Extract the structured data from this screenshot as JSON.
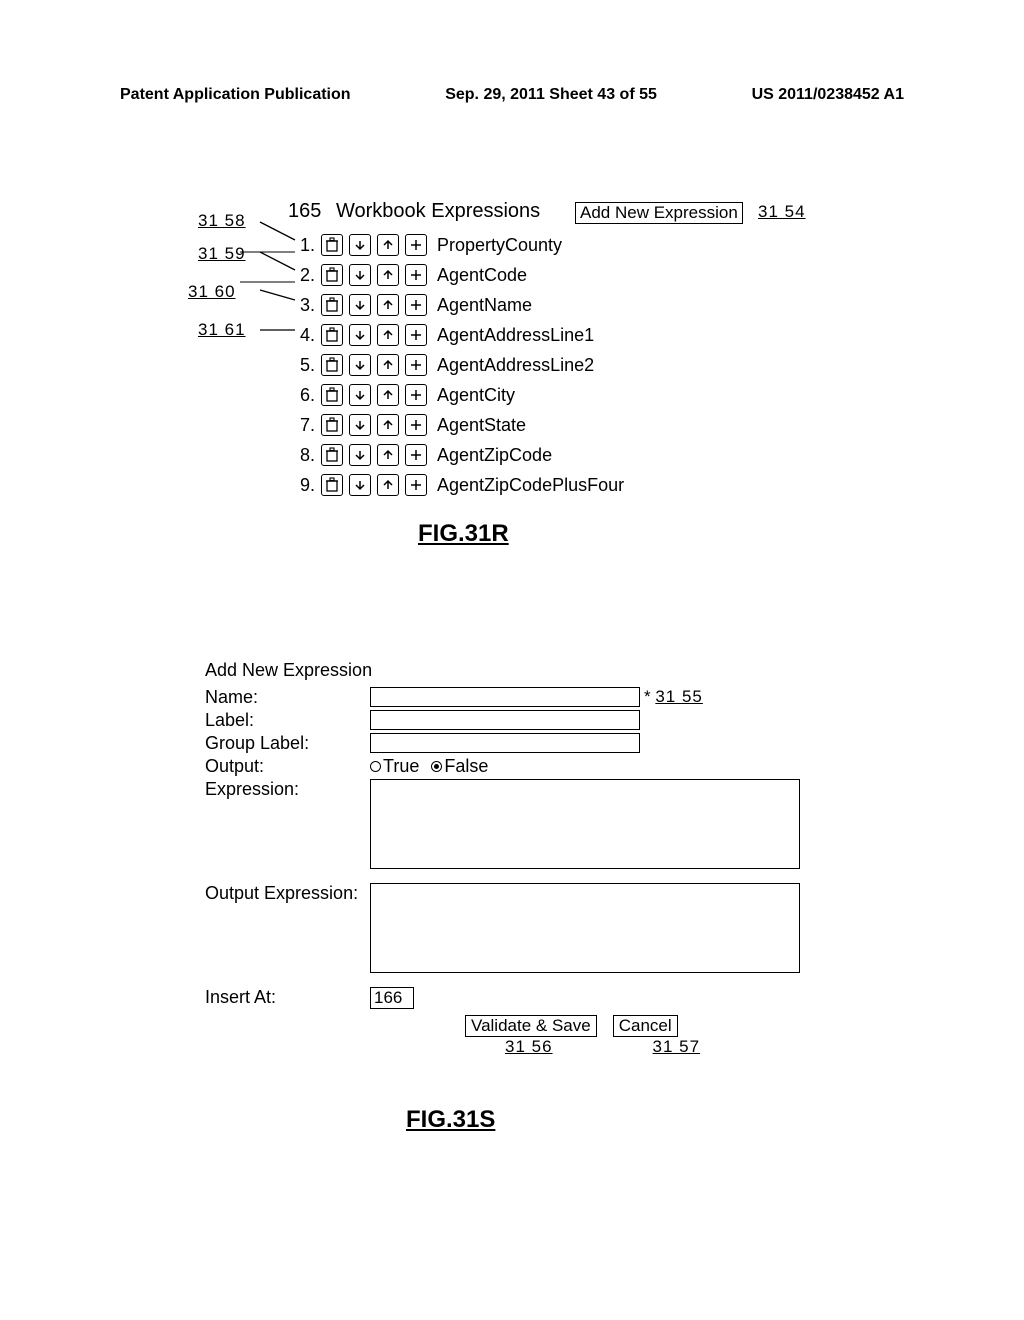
{
  "header": {
    "left": "Patent Application Publication",
    "mid": "Sep. 29, 2011  Sheet 43 of 55",
    "right": "US 2011/0238452 A1"
  },
  "fig_r": {
    "count": "165",
    "title": "Workbook Expressions",
    "add_btn": "Add New Expression",
    "ref_right": "31  54",
    "label": "FIG.31R",
    "leads": [
      {
        "ref": "31  58"
      },
      {
        "ref": "31  59"
      },
      {
        "ref": "31  60"
      },
      {
        "ref": "31  61"
      }
    ],
    "rows": [
      {
        "num": "1.",
        "name": "PropertyCounty"
      },
      {
        "num": "2.",
        "name": "AgentCode"
      },
      {
        "num": "3.",
        "name": "AgentName"
      },
      {
        "num": "4.",
        "name": "AgentAddressLine1"
      },
      {
        "num": "5.",
        "name": "AgentAddressLine2"
      },
      {
        "num": "6.",
        "name": "AgentCity"
      },
      {
        "num": "7.",
        "name": "AgentState"
      },
      {
        "num": "8.",
        "name": "AgentZipCode"
      },
      {
        "num": "9.",
        "name": "AgentZipCodePlusFour"
      }
    ]
  },
  "fig_s": {
    "title": "Add New Expression",
    "labels": {
      "name": "Name:",
      "label": "Label:",
      "group_label": "Group Label:",
      "output": "Output:",
      "expression": "Expression:",
      "output_expression": "Output Expression:",
      "insert_at": "Insert At:"
    },
    "radio_true": "True",
    "radio_false": "False",
    "insert_value": "166",
    "validate_btn": "Validate & Save",
    "cancel_btn": "Cancel",
    "ref_55": "31  55",
    "ref_56": "31  56",
    "ref_57": "31  57",
    "label": "FIG.31S"
  }
}
